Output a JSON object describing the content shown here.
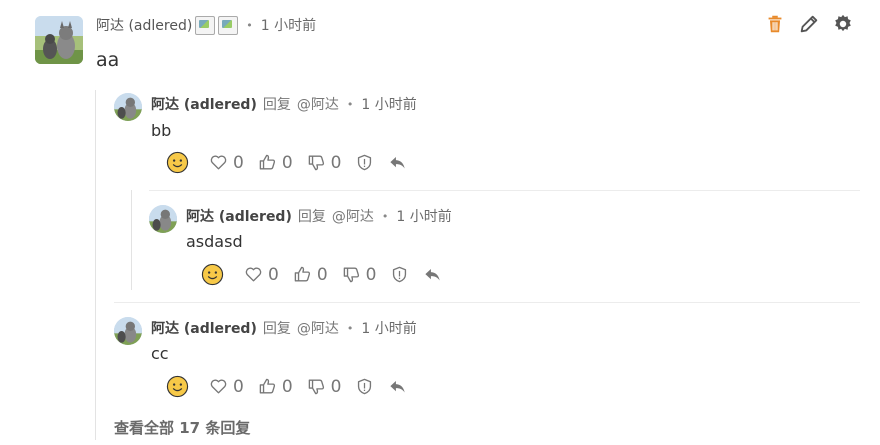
{
  "main_comment": {
    "author": "阿达 (adlered)",
    "time": "1 小时前",
    "body": "aa",
    "avatar": "cat-avatar"
  },
  "top_actions": {
    "delete_icon": "trash-icon",
    "edit_icon": "pencil-icon",
    "settings_icon": "gear-icon",
    "delete_color": "#e88a2b"
  },
  "replies": [
    {
      "author": "阿达 (adlered)",
      "reply_word": "回复",
      "mention": "@阿达",
      "time": "1 小时前",
      "body": "bb",
      "likes": "0",
      "thumbs_up": "0",
      "thumbs_down": "0"
    },
    {
      "author": "阿达 (adlered)",
      "reply_word": "回复",
      "mention": "@阿达",
      "time": "1 小时前",
      "body": "asdasd",
      "likes": "0",
      "thumbs_up": "0",
      "thumbs_down": "0"
    },
    {
      "author": "阿达 (adlered)",
      "reply_word": "回复",
      "mention": "@阿达",
      "time": "1 小时前",
      "body": "cc",
      "likes": "0",
      "thumbs_up": "0",
      "thumbs_down": "0"
    }
  ],
  "dot": "•",
  "view_all": "查看全部 17 条回复",
  "colors": {
    "emoji_yellow": "#f7c948",
    "text_muted": "#777777",
    "divider": "#e3e3e3"
  }
}
